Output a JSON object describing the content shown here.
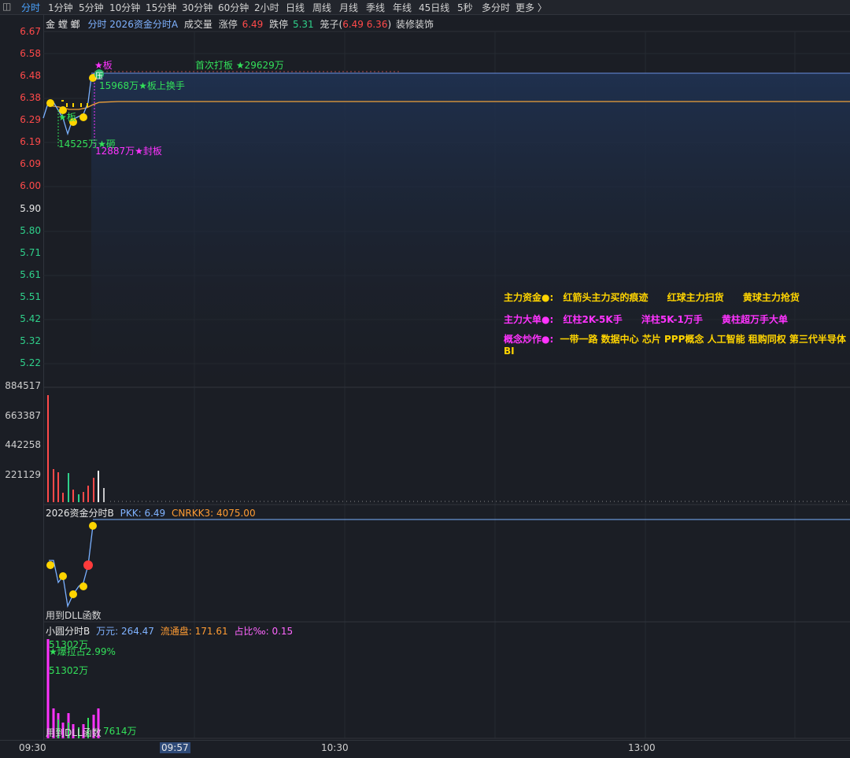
{
  "tabs": [
    {
      "label": "分时",
      "active": true
    },
    {
      "label": "1分钟"
    },
    {
      "label": "5分钟"
    },
    {
      "label": "10分钟"
    },
    {
      "label": "15分钟"
    },
    {
      "label": "30分钟"
    },
    {
      "label": "60分钟"
    },
    {
      "label": "2小时"
    },
    {
      "label": "日线"
    },
    {
      "label": "周线"
    },
    {
      "label": "月线"
    },
    {
      "label": "季线"
    },
    {
      "label": "年线"
    },
    {
      "label": "45日线"
    },
    {
      "label": "5秒"
    },
    {
      "label": "多分时"
    },
    {
      "label": "更多 〉"
    }
  ],
  "header": {
    "stock_name": "金 螳 螂",
    "indicator": "分时 2026资金分时A",
    "volume_label": "成交量",
    "limit_up_label": "涨停",
    "limit_up": "6.49",
    "limit_down_label": "跌停",
    "limit_down": "5.31",
    "cage_label": "笼子(",
    "cage_hi": "6.49",
    "cage_lo": "6.36",
    "cage_close": ")",
    "sector": "装修装饰"
  },
  "price_axis": {
    "up": [
      "6.67",
      "6.58",
      "6.48",
      "6.38",
      "6.29",
      "6.19",
      "6.09",
      "6.00"
    ],
    "mid": "5.90",
    "down": [
      "5.80",
      "5.71",
      "5.61",
      "5.51",
      "5.42",
      "5.32",
      "5.22"
    ]
  },
  "volume_axis": [
    "884517",
    "663387",
    "442258",
    "221129"
  ],
  "annotations": {
    "board": "★板",
    "first_board": "首次打板 ★29629万",
    "turnover": "15968万★板上换手",
    "smash": "14525万★砸",
    "seal": "12887万★封板",
    "ban": "★板",
    "tag": "压"
  },
  "legend": {
    "row1": {
      "title": "主力资金●:",
      "items": [
        "红箭头主力买的痕迹",
        "红球主力扫货",
        "黄球主力抢货"
      ]
    },
    "row2": {
      "title": "主力大单●:",
      "items": [
        "红柱2K-5K手",
        "洋柱5K-1万手",
        "黄柱超万手大单"
      ]
    },
    "row3": {
      "title": "概念炒作●:",
      "text": "一带一路 数据中心 芯片 PPP概念 人工智能 租购同权 第三代半导体 BI"
    }
  },
  "panel_b": {
    "name": "2026资金分时B",
    "pkk_label": "PKK:",
    "pkk": "6.49",
    "cnrkk_label": "CNRKK3:",
    "cnrkk": "4075.00",
    "footer": "用到DLL函数"
  },
  "panel_c": {
    "name": "小圆分时B",
    "wan_label": "万元:",
    "wan": "264.47",
    "float_label": "流通盘:",
    "float": "171.61",
    "ratio_label": "占比‰:",
    "ratio": "0.15",
    "a1": "51302万",
    "a2": "★爆拉占2.99%",
    "a3": "51302万",
    "a4": "7614万",
    "footer": "用到DLL函数"
  },
  "time_axis": {
    "t1": "09:30",
    "t2": "09:57",
    "t3": "10:30",
    "t4": "13:00"
  },
  "colors": {
    "up": "#ff4a4a",
    "down": "#2fd18b",
    "accent": "#4aa3ff",
    "yellow": "#ffd400",
    "magenta": "#ff33ff",
    "green": "#33e05a",
    "orange": "#ff9c33"
  }
}
